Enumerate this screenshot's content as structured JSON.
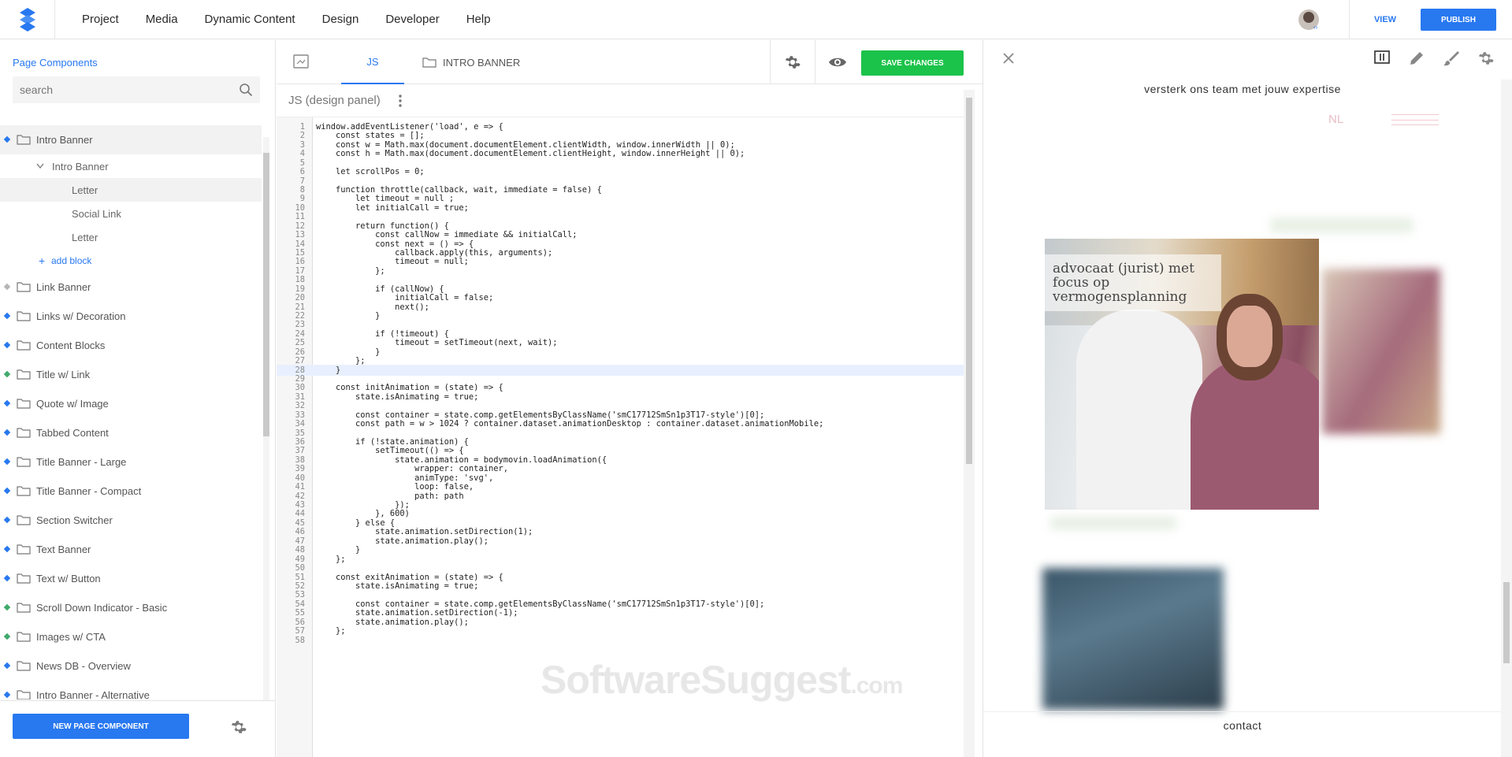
{
  "topbar": {
    "nav": [
      "Project",
      "Media",
      "Dynamic Content",
      "Design",
      "Developer",
      "Help"
    ],
    "view_label": "VIEW",
    "publish_label": "PUBLISH",
    "brand_color": "#2878f0"
  },
  "sidebar": {
    "title": "Page Components",
    "search_placeholder": "search",
    "items": [
      {
        "label": "Intro Banner",
        "dot": "blue",
        "selected": true
      },
      {
        "label": "Link Banner",
        "dot": "grey"
      },
      {
        "label": "Links w/ Decoration",
        "dot": "blue"
      },
      {
        "label": "Content Blocks",
        "dot": "blue"
      },
      {
        "label": "Title w/ Link",
        "dot": "green"
      },
      {
        "label": "Quote w/ Image",
        "dot": "blue"
      },
      {
        "label": "Tabbed Content",
        "dot": "blue"
      },
      {
        "label": "Title Banner - Large",
        "dot": "blue"
      },
      {
        "label": "Title Banner - Compact",
        "dot": "blue"
      },
      {
        "label": "Section Switcher",
        "dot": "blue"
      },
      {
        "label": "Text Banner",
        "dot": "blue"
      },
      {
        "label": "Text w/ Button",
        "dot": "blue"
      },
      {
        "label": "Scroll Down Indicator - Basic",
        "dot": "green"
      },
      {
        "label": "Images w/ CTA",
        "dot": "green"
      },
      {
        "label": "News DB - Overview",
        "dot": "blue"
      },
      {
        "label": "Intro Banner - Alternative",
        "dot": "blue"
      }
    ],
    "expanded": {
      "parent": "Intro Banner",
      "children": [
        "Letter",
        "Social Link",
        "Letter"
      ],
      "add_block": "add block"
    },
    "new_component_label": "NEW PAGE COMPONENT"
  },
  "editor": {
    "tab_label": "JS",
    "folder_label": "INTRO BANNER",
    "save_label": "SAVE CHANGES",
    "panel_label": "JS (design panel)",
    "active_line": 28,
    "lines": [
      "window.addEventListener('load', e => {",
      "    const states = [];",
      "    const w = Math.max(document.documentElement.clientWidth, window.innerWidth || 0);",
      "    const h = Math.max(document.documentElement.clientHeight, window.innerHeight || 0);",
      "",
      "    let scrollPos = 0;",
      "",
      "    function throttle(callback, wait, immediate = false) {",
      "        let timeout = null ;",
      "        let initialCall = true;",
      "",
      "        return function() {",
      "            const callNow = immediate && initialCall;",
      "            const next = () => {",
      "                callback.apply(this, arguments);",
      "                timeout = null;",
      "            };",
      "",
      "            if (callNow) {",
      "                initialCall = false;",
      "                next();",
      "            }",
      "",
      "            if (!timeout) {",
      "                timeout = setTimeout(next, wait);",
      "            }",
      "        };",
      "    }",
      "",
      "    const initAnimation = (state) => {",
      "        state.isAnimating = true;",
      "",
      "        const container = state.comp.getElementsByClassName('smC17712SmSn1p3T17-style')[0];",
      "        const path = w > 1024 ? container.dataset.animationDesktop : container.dataset.animationMobile;",
      "",
      "        if (!state.animation) {",
      "            setTimeout(() => {",
      "                state.animation = bodymovin.loadAnimation({",
      "                    wrapper: container,",
      "                    animType: 'svg',",
      "                    loop: false,",
      "                    path: path",
      "                });",
      "            }, 600)",
      "        } else {",
      "            state.animation.setDirection(1);",
      "            state.animation.play();",
      "        }",
      "    };",
      "",
      "    const exitAnimation = (state) => {",
      "        state.isAnimating = true;",
      "",
      "        const container = state.comp.getElementsByClassName('smC17712SmSn1p3T17-style')[0];",
      "        state.animation.setDirection(-1);",
      "        state.animation.play();",
      "    };",
      ""
    ],
    "watermark": "SoftwareSuggest",
    "watermark_suffix": ".com"
  },
  "preview": {
    "heading": "versterk ons team met jouw expertise",
    "lang": "NL",
    "hero_caption": "advocaat (jurist) met focus op vermogensplanning",
    "footer": "contact"
  }
}
